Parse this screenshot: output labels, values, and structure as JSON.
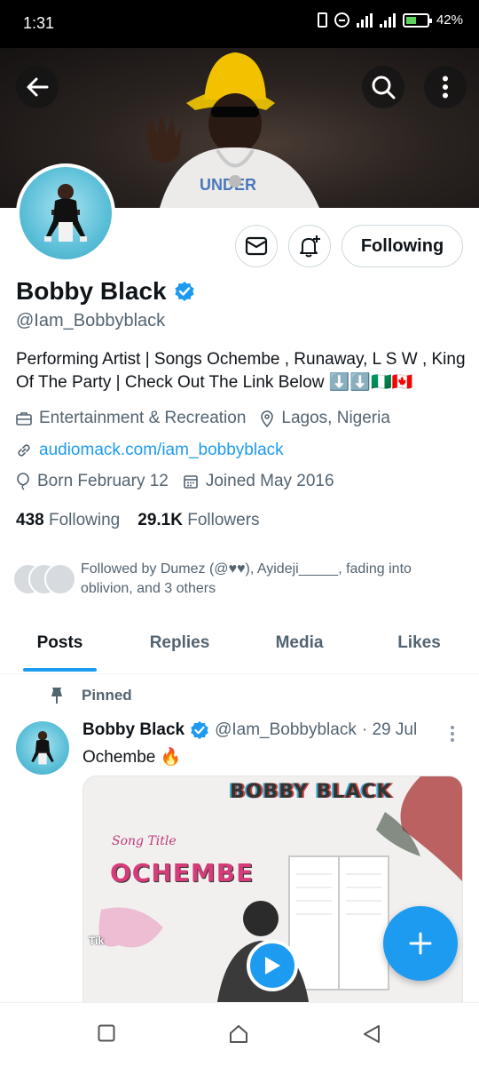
{
  "status_bar": {
    "time": "1:31",
    "battery": "42%"
  },
  "header": {
    "back_icon": "arrow-left-icon",
    "search_icon": "search-icon",
    "more_icon": "more-vertical-icon"
  },
  "actions": {
    "message_icon": "mail-icon",
    "notify_icon": "bell-plus-icon",
    "follow_label": "Following"
  },
  "profile": {
    "name": "Bobby Black",
    "handle": "@Iam_Bobbyblack",
    "bio": "Performing Artist | Songs Ochembe , Runaway, L S W , King Of The Party | Check Out The Link Below ⬇️⬇️🇳🇬🇨🇦",
    "category": "Entertainment & Recreation",
    "location": "Lagos, Nigeria",
    "link": "audiomack.com/iam_bobbyblack",
    "birthday": "Born February 12",
    "joined": "Joined May 2016",
    "following_count": "438",
    "following_label": "Following",
    "followers_count": "29.1K",
    "followers_label": "Followers",
    "followed_by": "Followed by Dumez (@♥♥), Ayideji_____, fading into oblivion, and 3 others"
  },
  "tabs": [
    {
      "label": "Posts",
      "active": true
    },
    {
      "label": "Replies",
      "active": false
    },
    {
      "label": "Media",
      "active": false
    },
    {
      "label": "Likes",
      "active": false
    }
  ],
  "pinned_tweet": {
    "pinned_label": "Pinned",
    "author": "Bobby Black",
    "handle": "@Iam_Bobbyblack",
    "date": "· 29 Jul",
    "text": "Ochembe 🔥",
    "media": {
      "top_text": "BOBBY BLACK",
      "script_text": "Song Title",
      "title_text": "OCHEMBE",
      "watermark": "Tik"
    }
  },
  "colors": {
    "accent": "#1d9bf0",
    "text_primary": "#0f1419",
    "text_secondary": "#536471"
  }
}
